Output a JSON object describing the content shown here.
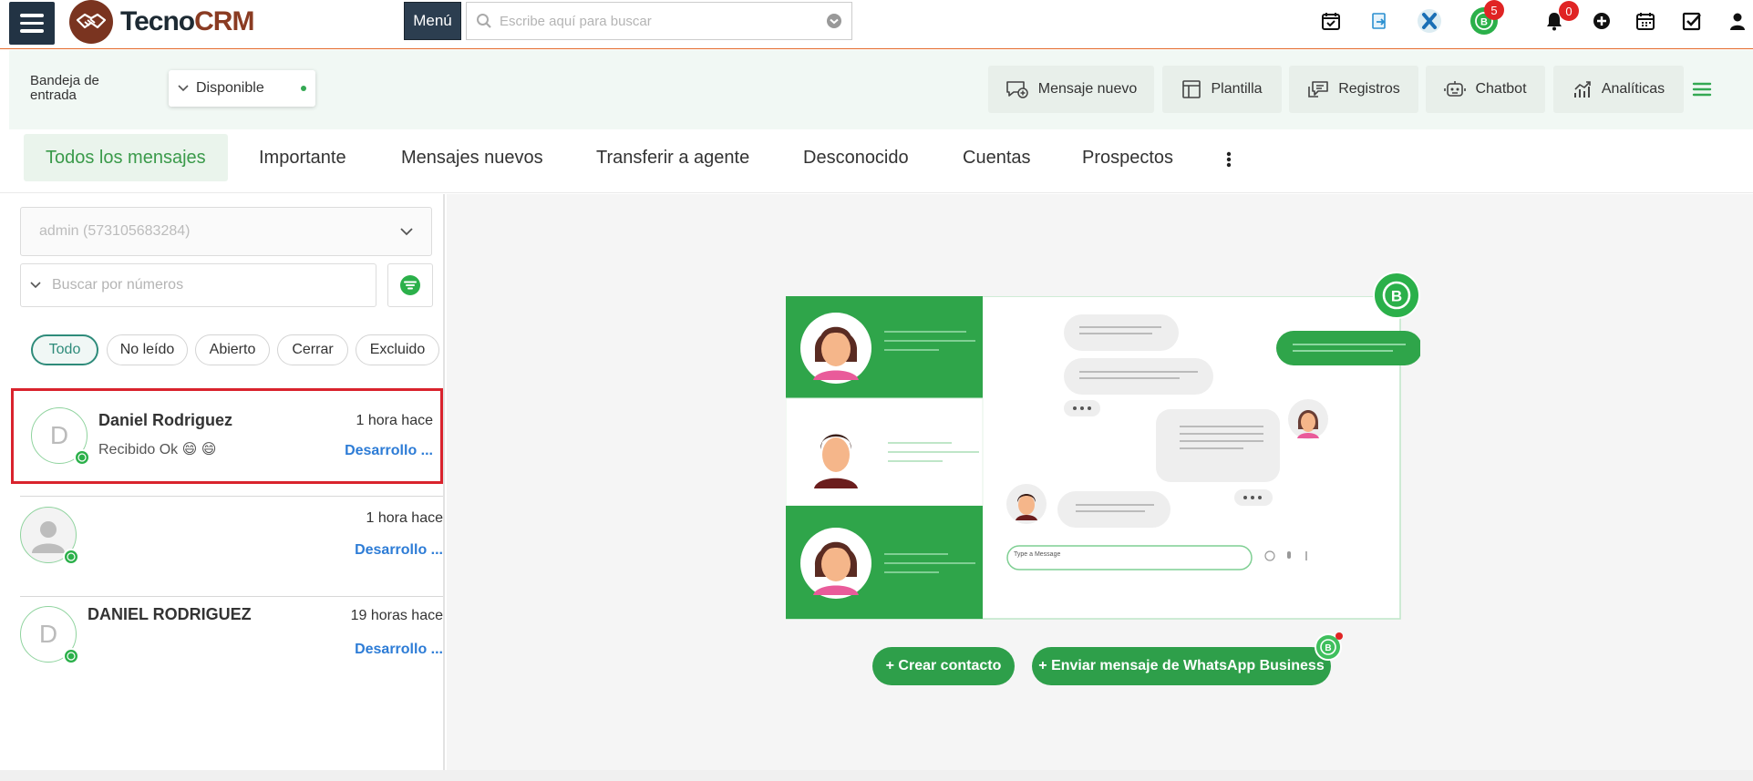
{
  "header": {
    "logo_text_1": "Tecno",
    "logo_text_2": "CRM",
    "menu_label": "Menú",
    "search_placeholder": "Escribe aquí para buscar",
    "whatsapp_badge": "5",
    "notifications_badge": "0"
  },
  "toolbar": {
    "inbox_label": "Bandeja de entrada",
    "status_value": "Disponible",
    "buttons": {
      "new_message": "Mensaje nuevo",
      "template": "Plantilla",
      "records": "Registros",
      "chatbot": "Chatbot",
      "analytics": "Analíticas"
    }
  },
  "tabs": [
    "Todos los mensajes",
    "Importante",
    "Mensajes nuevos",
    "Transferir a agente",
    "Desconocido",
    "Cuentas",
    "Prospectos"
  ],
  "left": {
    "account_select": "admin (573105683284)",
    "number_search_placeholder": "Buscar por números",
    "filters": [
      "Todo",
      "No leído",
      "Abierto",
      "Cerrar",
      "Excluido"
    ]
  },
  "conversations": [
    {
      "initial": "D",
      "name": "Daniel Rodriguez",
      "time": "1 hora hace",
      "preview": "Recibido Ok 😄 😄",
      "link": "Desarrollo ..."
    },
    {
      "initial": "",
      "name": "",
      "time": "1 hora hace",
      "preview": "",
      "link": "Desarrollo ..."
    },
    {
      "initial": "D",
      "name": "DANIEL RODRIGUEZ",
      "time": "19 horas hace",
      "preview": "",
      "link": "Desarrollo ..."
    }
  ],
  "illustration": {
    "input_placeholder": "Type a Message"
  },
  "actions": {
    "create_contact": "+ Crear contacto",
    "send_whatsapp": "+ Enviar mensaje de WhatsApp Business"
  },
  "colors": {
    "accent_green": "#2e9f4a",
    "link_blue": "#2d7cd6",
    "badge_red": "#e02424",
    "header_dark": "#2c3e50",
    "selection_red": "#d9232d"
  }
}
